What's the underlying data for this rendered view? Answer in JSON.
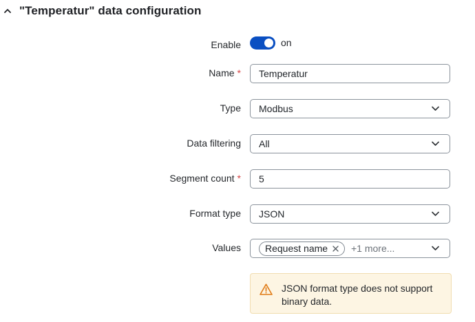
{
  "section": {
    "title": "\"Temperatur\" data configuration",
    "collapse_icon": "chevron-up-icon"
  },
  "fields": {
    "enable": {
      "label": "Enable",
      "state": "on",
      "checked": true
    },
    "name": {
      "label": "Name",
      "required_marker": "*",
      "value": "Temperatur"
    },
    "type": {
      "label": "Type",
      "value": "Modbus"
    },
    "data_filtering": {
      "label": "Data filtering",
      "value": "All"
    },
    "segment_count": {
      "label": "Segment count",
      "required_marker": "*",
      "value": "5"
    },
    "format_type": {
      "label": "Format type",
      "value": "JSON"
    },
    "values": {
      "label": "Values",
      "chip": "Request name",
      "more": "+1 more..."
    }
  },
  "warning": {
    "icon": "warning-triangle-icon",
    "text": "JSON format type does not support binary data."
  },
  "colors": {
    "accent": "#0a4fc2",
    "required": "#d64545",
    "warning_bg": "#fdf5e3",
    "warning_icon": "#e07b16"
  }
}
